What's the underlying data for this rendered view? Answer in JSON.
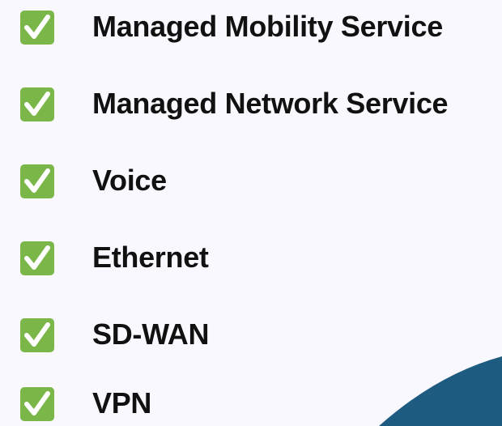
{
  "services": [
    {
      "label": "Managed Mobility Service",
      "icon": "checkmark-icon"
    },
    {
      "label": "Managed Network Service",
      "icon": "checkmark-icon"
    },
    {
      "label": "Voice",
      "icon": "checkmark-icon"
    },
    {
      "label": "Ethernet",
      "icon": "checkmark-icon"
    },
    {
      "label": "SD-WAN",
      "icon": "checkmark-icon"
    },
    {
      "label": "VPN",
      "icon": "checkmark-icon"
    }
  ],
  "colors": {
    "background": "#f8f8fe",
    "checkbox_fill": "#7ab648",
    "checkmark": "#ffffff",
    "text": "#111111",
    "decoration": "#1d5c80"
  }
}
